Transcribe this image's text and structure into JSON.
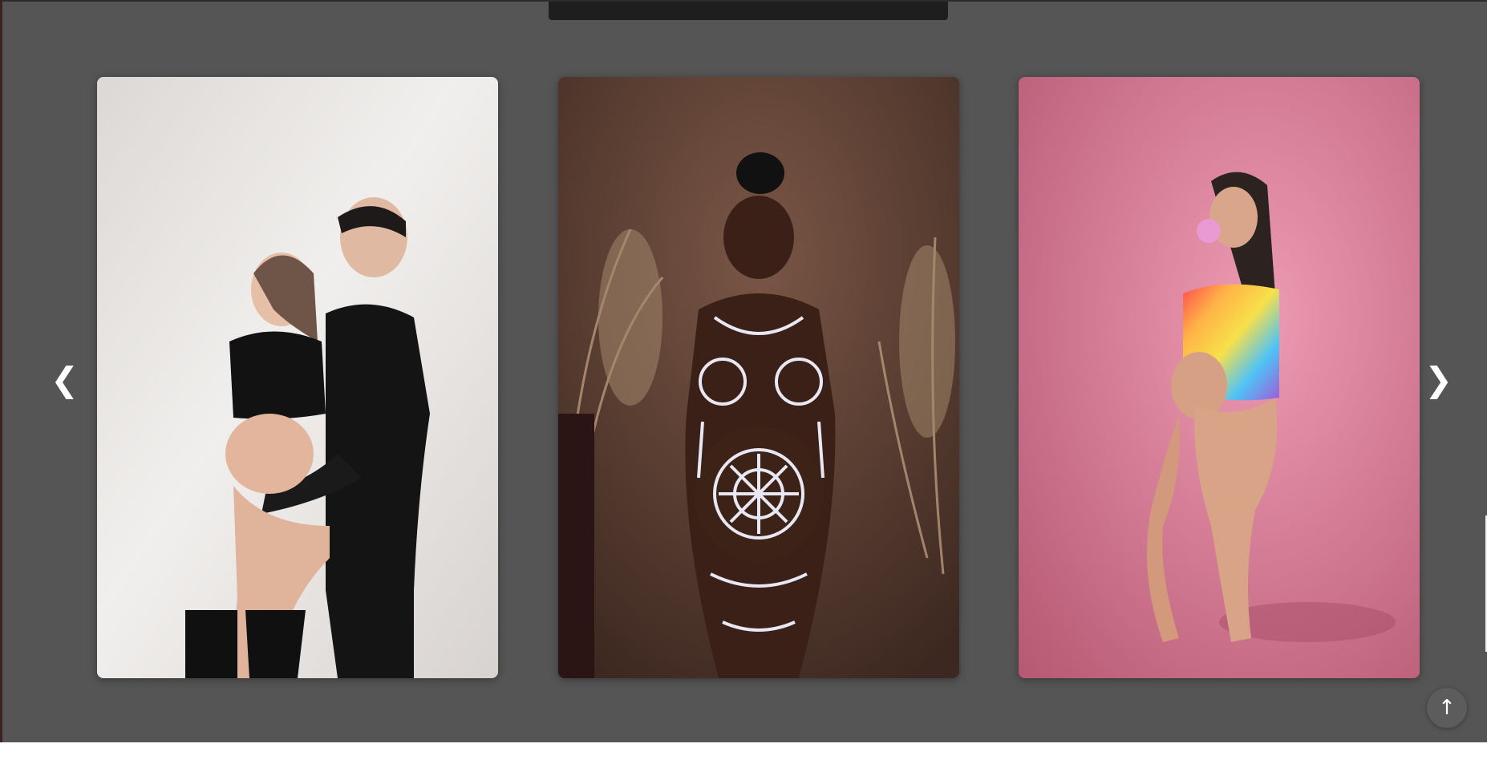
{
  "header": {
    "tooltip_text": "",
    "top_line_color": "#2c2c2c"
  },
  "gallery": {
    "background": "#555555",
    "prev_label": "❮",
    "next_label": "❯",
    "images": [
      {
        "name": "couple-maternity-photo",
        "background": "#e4e0dd"
      },
      {
        "name": "body-paint-maternity-photo",
        "background": "#563c2e"
      },
      {
        "name": "pink-backdrop-maternity-photo",
        "background": "#e08ea6"
      }
    ]
  },
  "scroll_top": {
    "label": "↑",
    "icon": "arrow-up-icon"
  }
}
